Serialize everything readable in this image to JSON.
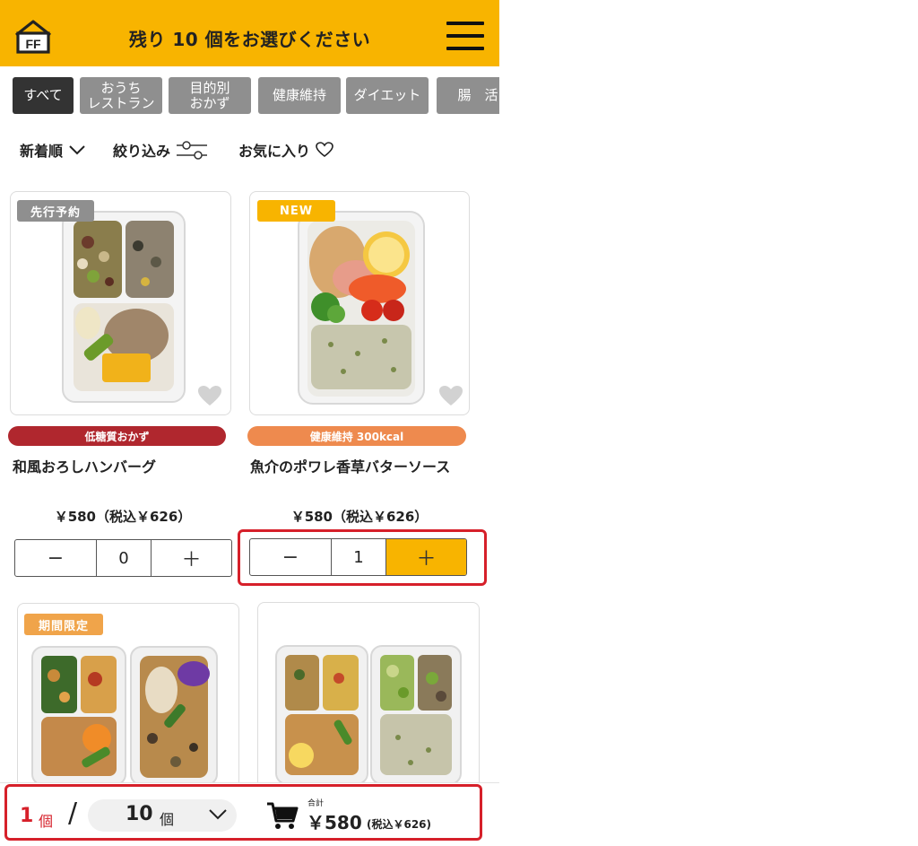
{
  "header": {
    "logo_text": "FF",
    "title": "残り 10 個をお選びください"
  },
  "tabs": [
    {
      "label": "すべて",
      "active": true
    },
    {
      "label": "おうち\nレストラン",
      "active": false
    },
    {
      "label": "目的別\nおかず",
      "active": false
    },
    {
      "label": "健康維持",
      "active": false
    },
    {
      "label": "ダイエット",
      "active": false
    },
    {
      "label": "腸　活",
      "active": false
    }
  ],
  "sort": {
    "newest": "新着順",
    "filter": "絞り込み",
    "favorites": "お気に入り"
  },
  "products": [
    {
      "badge": "先行予約",
      "badge_color": "#8f8f8f",
      "category": "低糖質おかず",
      "category_color": "#b0272e",
      "name": "和風おろしハンバーグ",
      "price": "￥580（税込￥626）",
      "quantity": "0",
      "minus": "−",
      "plus": "＋"
    },
    {
      "badge": "NEW",
      "badge_color": "#f8b400",
      "category": "健康維持 300kcal",
      "category_color": "#ee8a4e",
      "name": "魚介のポワレ香草バターソース",
      "price": "￥580（税込￥626）",
      "quantity": "1",
      "minus": "−",
      "plus": "＋"
    },
    {
      "badge": "期間限定",
      "badge_color": "#f0a44a"
    },
    {
      "badge": ""
    }
  ],
  "bottom_bar": {
    "selected_count": "1",
    "selected_unit": "個",
    "separator": "/",
    "limit_count": "10",
    "limit_unit": "個",
    "total_label": "合計",
    "total_price": "￥580",
    "total_tax": "(税込￥626)"
  },
  "colors": {
    "brand": "#f8b400",
    "highlight": "#d6202a"
  }
}
